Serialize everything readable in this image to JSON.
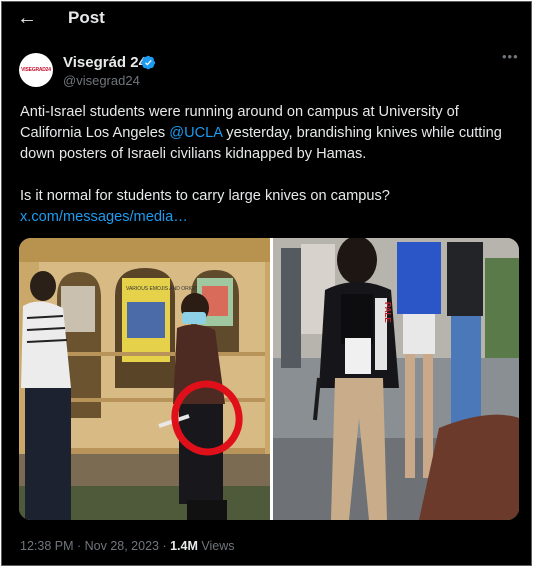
{
  "header": {
    "title": "Post",
    "back_icon": "arrow-left-icon"
  },
  "author": {
    "avatar_text": "VISEGRAD24",
    "name": "Visegrád 24",
    "handle": "@visegrad24",
    "verified": true,
    "badge_color": "#1d9bf0"
  },
  "post": {
    "line1_before": "Anti-Israel students were running around on campus at University of California Los Angeles ",
    "mention": "@UCLA",
    "line1_after": " yesterday, brandishing knives while cutting down posters of Israeli civilians kidnapped by Hamas.",
    "paragraph2": "Is it normal for students to carry large knives on campus?",
    "link": "x.com/messages/media…"
  },
  "media": {
    "left_image_sign": "VARIOUS EMOJIS AND ORIGINAL ART",
    "left_image_annotation": "red-circle-highlight",
    "right_image_scarf_text": "PALE"
  },
  "footer": {
    "time": "12:38 PM",
    "separator": " · ",
    "date": "Nov 28, 2023",
    "separator2": " · ",
    "views_count": "1.4M",
    "views_label": " Views"
  },
  "colors": {
    "background": "#000000",
    "text": "#e7e9ea",
    "secondary": "#71767b",
    "accent": "#1d9bf0",
    "highlight_circle": "#e0101a"
  }
}
